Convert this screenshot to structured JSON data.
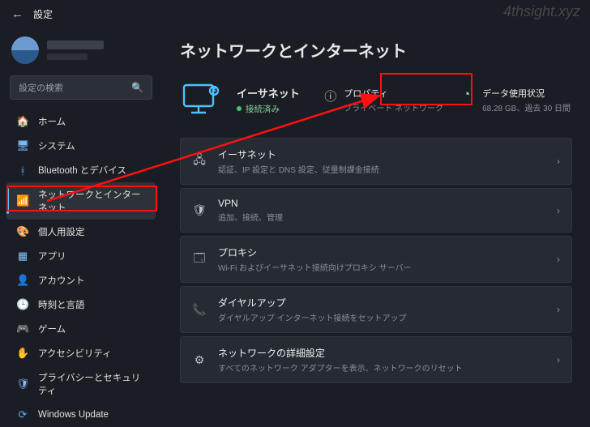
{
  "window": {
    "title": "設定"
  },
  "watermark": "4thsight.xyz",
  "search": {
    "placeholder": "設定の検索"
  },
  "sidebar": {
    "items": [
      {
        "icon": "🏠",
        "label": "ホーム",
        "color": "#6fb3ff"
      },
      {
        "icon": "🖥",
        "label": "システム",
        "color": "#7db8ff"
      },
      {
        "icon": "ᚼ",
        "label": "Bluetooth とデバイス",
        "color": "#4aa3ff"
      },
      {
        "icon": "📶",
        "label": "ネットワークとインターネット",
        "active": true,
        "color": "#4cc2ff"
      },
      {
        "icon": "🎨",
        "label": "個人用設定",
        "color": "#a08cff"
      },
      {
        "icon": "▦",
        "label": "アプリ",
        "color": "#7fc9ff"
      },
      {
        "icon": "👤",
        "label": "アカウント",
        "color": "#ffb870"
      },
      {
        "icon": "🕒",
        "label": "時刻と言語",
        "color": "#6fd2b8"
      },
      {
        "icon": "🎮",
        "label": "ゲーム",
        "color": "#9aa0a8"
      },
      {
        "icon": "✋",
        "label": "アクセシビリティ",
        "color": "#6fc5ff"
      },
      {
        "icon": "🛡",
        "label": "プライバシーとセキュリティ",
        "color": "#8fb5ff"
      },
      {
        "icon": "⟳",
        "label": "Windows Update",
        "color": "#5cb0ff"
      }
    ]
  },
  "page": {
    "heading": "ネットワークとインターネット",
    "status": {
      "name": "イーサネット",
      "state": "接続済み",
      "blocks": {
        "properties": {
          "title": "プロパティ",
          "subtitle": "プライベート ネットワーク"
        },
        "data": {
          "title": "データ使用状況",
          "subtitle": "68.28 GB、過去 30 日間"
        }
      }
    },
    "rows": [
      {
        "icon": "🖧",
        "title": "イーサネット",
        "subtitle": "認証、IP 設定と DNS 設定、従量制課金接続"
      },
      {
        "icon": "🛡",
        "title": "VPN",
        "subtitle": "追加、接続、管理"
      },
      {
        "icon": "🗔",
        "title": "プロキシ",
        "subtitle": "Wi-Fi およびイーサネット接続向けプロキシ サーバー"
      },
      {
        "icon": "📞",
        "title": "ダイヤルアップ",
        "subtitle": "ダイヤルアップ インターネット接続をセットアップ"
      },
      {
        "icon": "⚙",
        "title": "ネットワークの詳細設定",
        "subtitle": "すべてのネットワーク アダプターを表示、ネットワークのリセット"
      }
    ]
  }
}
